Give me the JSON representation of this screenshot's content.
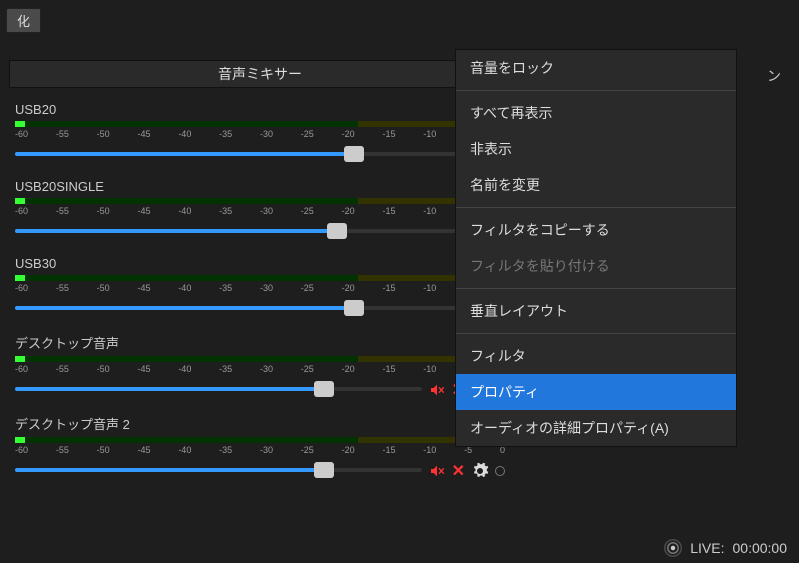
{
  "titlebar": {
    "btn": "化"
  },
  "mixer": {
    "header": "音声ミキサー",
    "ticks": [
      "-60",
      "-55",
      "-50",
      "-45",
      "-40",
      "-35",
      "-30",
      "-25",
      "-20",
      "-15",
      "-10",
      "-5",
      "0"
    ],
    "channels": [
      {
        "name": "USB20",
        "level": "0.0",
        "slider": 76,
        "gear": false
      },
      {
        "name": "USB20SINGLE",
        "level": "0.0",
        "slider": 72,
        "gear": false
      },
      {
        "name": "USB30",
        "level": "0.0",
        "slider": 76,
        "gear": false
      },
      {
        "name": "デスクトップ音声",
        "level": "0.0",
        "slider": 76,
        "gear": true
      },
      {
        "name": "デスクトップ音声 2",
        "level": "0.0 dB",
        "slider": 76,
        "gear": true
      }
    ]
  },
  "context_menu": {
    "groups": [
      [
        {
          "label": "音量をロック",
          "state": "normal"
        }
      ],
      [
        {
          "label": "すべて再表示",
          "state": "normal"
        },
        {
          "label": "非表示",
          "state": "normal"
        },
        {
          "label": "名前を変更",
          "state": "normal"
        }
      ],
      [
        {
          "label": "フィルタをコピーする",
          "state": "normal"
        },
        {
          "label": "フィルタを貼り付ける",
          "state": "disabled"
        }
      ],
      [
        {
          "label": "垂直レイアウト",
          "state": "normal"
        }
      ],
      [
        {
          "label": "フィルタ",
          "state": "normal"
        },
        {
          "label": "プロパティ",
          "state": "highlight"
        },
        {
          "label": "オーディオの詳細プロパティ(A)",
          "state": "normal"
        }
      ]
    ]
  },
  "status": {
    "live_label": "LIVE:",
    "time": "00:00:00"
  },
  "fragments": {
    "right_cut": "ン"
  },
  "icons": {
    "speaker": "speaker-muted-icon",
    "close": "✕",
    "gear": "gear-icon",
    "live": "broadcast-icon"
  }
}
